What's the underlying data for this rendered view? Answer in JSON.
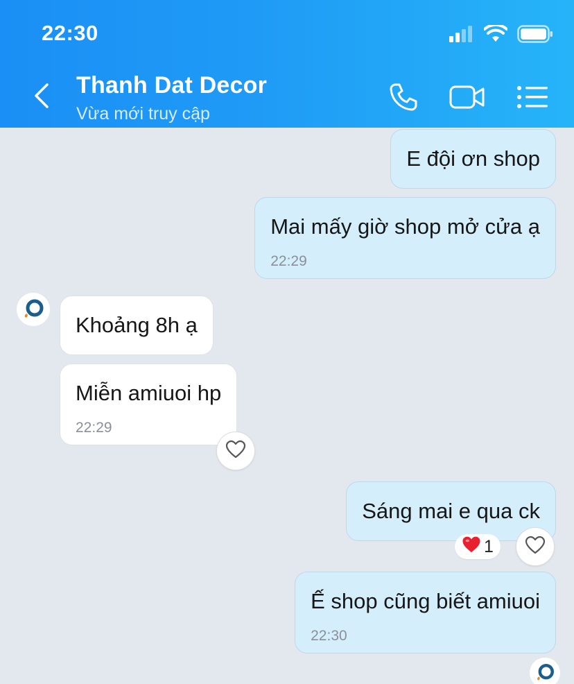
{
  "status_bar": {
    "time": "22:30"
  },
  "header": {
    "contact_name": "Thanh Dat Decor",
    "contact_status": "Vừa mới truy cập",
    "accent_color": "#1a8ff5"
  },
  "messages": [
    {
      "direction": "outgoing",
      "text": "E đội ơn shop"
    },
    {
      "direction": "outgoing",
      "text": "Mai mấy giờ shop mở cửa ạ",
      "time": "22:29"
    },
    {
      "direction": "incoming",
      "text": "Khoảng 8h ạ"
    },
    {
      "direction": "incoming",
      "text": "Miễn amiuoi hp",
      "time": "22:29"
    },
    {
      "direction": "outgoing",
      "text": "Sáng mai e qua ck",
      "reaction": {
        "icon": "red-heart",
        "count": "1"
      }
    },
    {
      "direction": "outgoing",
      "text": "Ế shop cũng biết amiuoi",
      "time": "22:30"
    }
  ],
  "icons": [
    "back-chevron-icon",
    "phone-icon",
    "video-camera-icon",
    "menu-list-icon",
    "heart-outline-icon",
    "signal-icon",
    "wifi-icon",
    "battery-icon"
  ]
}
